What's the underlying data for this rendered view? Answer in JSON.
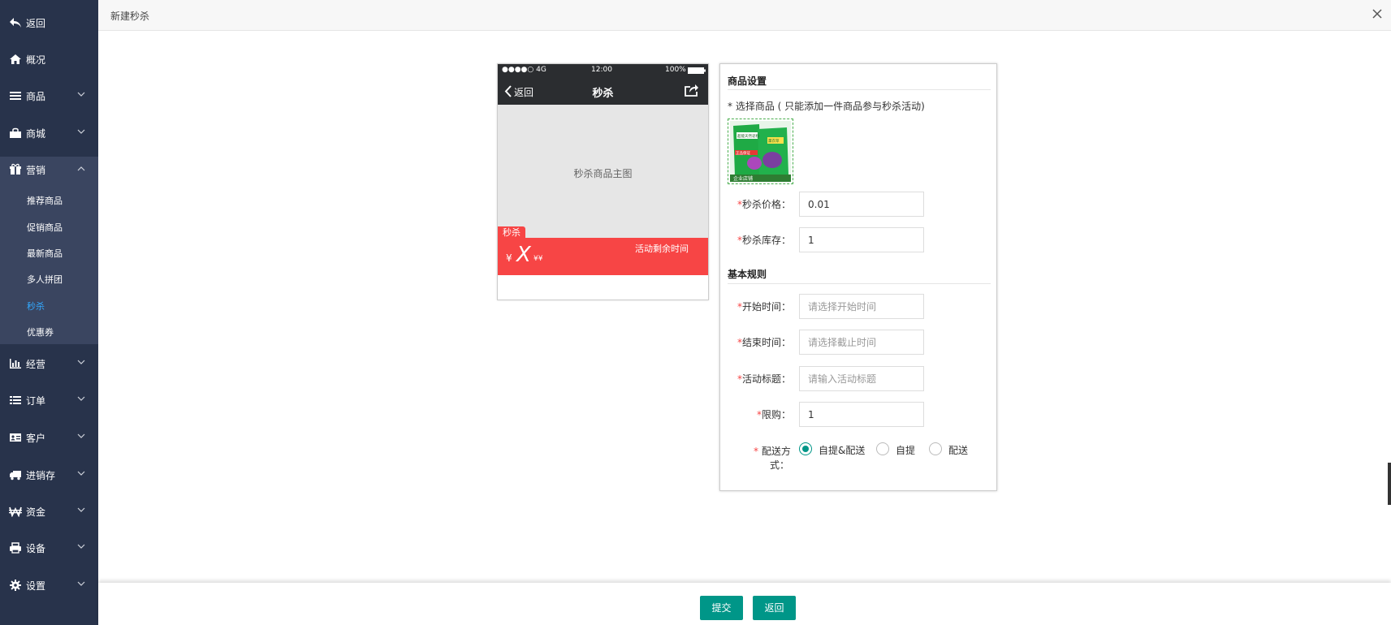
{
  "sidebar": {
    "back": "返回",
    "overview": "概况",
    "goods": "商品",
    "mall": "商城",
    "marketing": "营销",
    "marketing_sub": [
      "推荐商品",
      "促销商品",
      "最新商品",
      "多人拼团",
      "秒杀",
      "优惠券"
    ],
    "operations": "经营",
    "orders": "订单",
    "customers": "客户",
    "inventory": "进销存",
    "funds": "资金",
    "devices": "设备",
    "settings": "设置"
  },
  "header": {
    "title": "新建秒杀"
  },
  "phone": {
    "carrier": "●●●●○ 4G",
    "time": "12:00",
    "battery": "100%",
    "back": "返回",
    "title": "秒杀",
    "main_image_placeholder": "秒杀商品主图",
    "tag": "秒杀",
    "currency": "¥",
    "price": "X",
    "original_price": "¥¥",
    "countdown_label": "活动剩余时间"
  },
  "form": {
    "goods_section": "商品设置",
    "select_goods_label": "* 选择商品 ( 只能添加一件商品参与秒杀活动)",
    "product_image_text": [
      "超能天然皂粉",
      "薰衣草",
      "正品保证",
      "企业店铺"
    ],
    "price_label": "秒杀价格：",
    "price_value": "0.01",
    "stock_label": "秒杀库存：",
    "stock_value": "1",
    "rules_section": "基本规则",
    "start_label": "开始时间：",
    "start_placeholder": "请选择开始时间",
    "end_label": "结束时间：",
    "end_placeholder": "请选择截止时间",
    "title_label": "活动标题：",
    "title_placeholder": "请输入活动标题",
    "limit_label": "限购：",
    "limit_value": "1",
    "delivery_label_1": "配送方",
    "delivery_label_2": "式：",
    "delivery_options": [
      "自提&配送",
      "自提",
      "配送"
    ],
    "delivery_selected": "自提&配送"
  },
  "footer": {
    "submit": "提交",
    "back": "返回"
  },
  "colors": {
    "sidebar_bg": "#28334b",
    "accent": "#009688",
    "seckill_red": "#f74545",
    "active_submenu": "#33a9ff"
  }
}
